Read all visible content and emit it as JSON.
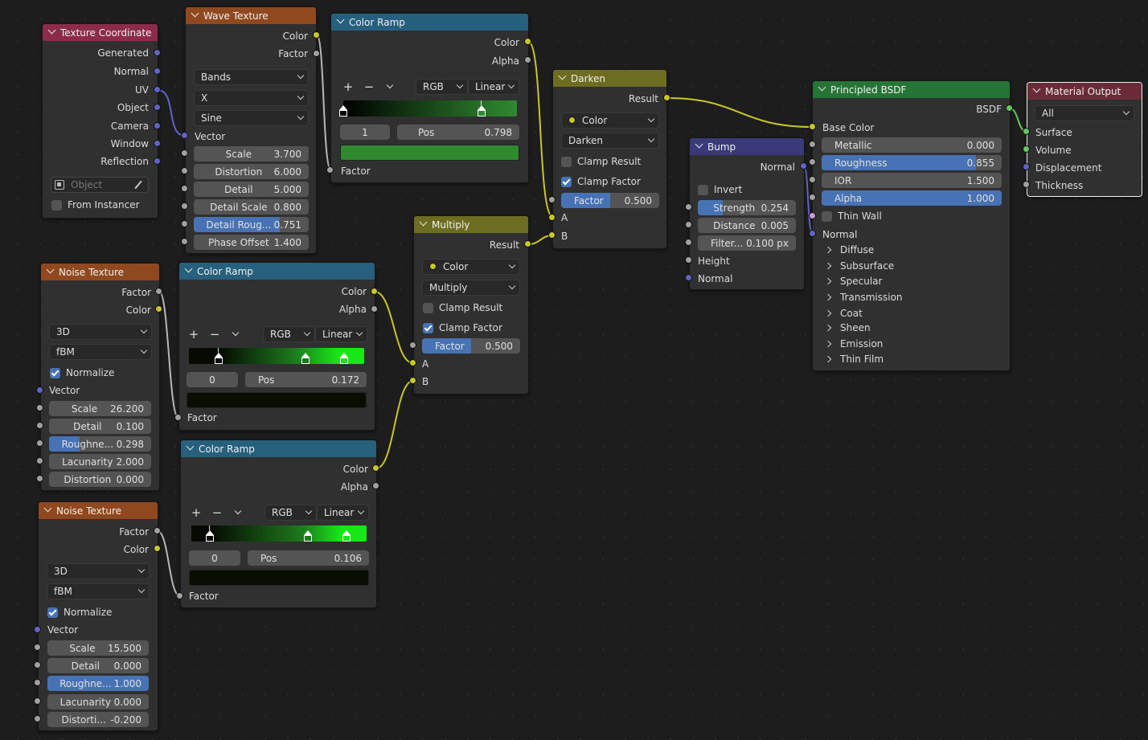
{
  "nodes": {
    "tex_coord": {
      "title": "Texture Coordinate",
      "outputs": [
        "Generated",
        "Normal",
        "UV",
        "Object",
        "Camera",
        "Window",
        "Reflection"
      ],
      "object_placeholder": "Object",
      "from_instancer": "From Instancer"
    },
    "wave": {
      "title": "Wave Texture",
      "outputs": [
        "Color",
        "Factor"
      ],
      "type": "Bands",
      "direction": "X",
      "profile": "Sine",
      "vector": "Vector",
      "fields": [
        {
          "label": "Scale",
          "value": "3.700"
        },
        {
          "label": "Distortion",
          "value": "6.000"
        },
        {
          "label": "Detail",
          "value": "5.000"
        },
        {
          "label": "Detail Scale",
          "value": "0.800"
        },
        {
          "label": "Detail Roug...",
          "value": "0.751"
        },
        {
          "label": "Phase Offset",
          "value": "1.400"
        }
      ]
    },
    "ramp1": {
      "title": "Color Ramp",
      "outputs": [
        "Color",
        "Alpha"
      ],
      "mode": "RGB",
      "interp": "Linear",
      "index": "1",
      "pos_label": "Pos",
      "pos": "0.798",
      "input": "Factor",
      "swatch": "#2f8a2f"
    },
    "darken": {
      "title": "Darken",
      "output": "Result",
      "data_type": "Color",
      "blend": "Darken",
      "clamp_result": "Clamp Result",
      "clamp_factor": "Clamp Factor",
      "factor_label": "Factor",
      "factor": "0.500",
      "inputs": [
        "A",
        "B"
      ]
    },
    "multiply": {
      "title": "Multiply",
      "output": "Result",
      "data_type": "Color",
      "blend": "Multiply",
      "clamp_result": "Clamp Result",
      "clamp_factor": "Clamp Factor",
      "factor_label": "Factor",
      "factor": "0.500",
      "inputs": [
        "A",
        "B"
      ]
    },
    "bump": {
      "title": "Bump",
      "output": "Normal",
      "invert": "Invert",
      "fields": [
        {
          "label": "Strength",
          "value": "0.254"
        },
        {
          "label": "Distance",
          "value": "0.005"
        },
        {
          "label": "Filter...",
          "value": "0.100 px"
        }
      ],
      "inputs": [
        "Height",
        "Normal"
      ]
    },
    "bsdf": {
      "title": "Principled BSDF",
      "output": "BSDF",
      "base_color": "Base Color",
      "fields": [
        {
          "label": "Metallic",
          "value": "0.000"
        },
        {
          "label": "Roughness",
          "value": "0.855"
        },
        {
          "label": "IOR",
          "value": "1.500"
        },
        {
          "label": "Alpha",
          "value": "1.000"
        }
      ],
      "thin_wall": "Thin Wall",
      "normal": "Normal",
      "panels": [
        "Diffuse",
        "Subsurface",
        "Specular",
        "Transmission",
        "Coat",
        "Sheen",
        "Emission",
        "Thin Film"
      ]
    },
    "output": {
      "title": "Material Output",
      "target": "All",
      "inputs": [
        "Surface",
        "Volume",
        "Displacement",
        "Thickness"
      ]
    },
    "noise1": {
      "title": "Noise Texture",
      "outputs": [
        "Factor",
        "Color"
      ],
      "dims": "3D",
      "type": "fBM",
      "normalize": "Normalize",
      "vector": "Vector",
      "fields": [
        {
          "label": "Scale",
          "value": "26.200"
        },
        {
          "label": "Detail",
          "value": "0.100"
        },
        {
          "label": "Roughne...",
          "value": "0.298"
        },
        {
          "label": "Lacunarity",
          "value": "2.000"
        },
        {
          "label": "Distortion",
          "value": "0.000"
        }
      ]
    },
    "ramp2": {
      "title": "Color Ramp",
      "outputs": [
        "Color",
        "Alpha"
      ],
      "mode": "RGB",
      "interp": "Linear",
      "index": "0",
      "pos_label": "Pos",
      "pos": "0.172",
      "input": "Factor",
      "swatch": "#080f02"
    },
    "ramp3": {
      "title": "Color Ramp",
      "outputs": [
        "Color",
        "Alpha"
      ],
      "mode": "RGB",
      "interp": "Linear",
      "index": "0",
      "pos_label": "Pos",
      "pos": "0.106",
      "input": "Factor",
      "swatch": "#080f02"
    },
    "noise2": {
      "title": "Noise Texture",
      "outputs": [
        "Factor",
        "Color"
      ],
      "dims": "3D",
      "type": "fBM",
      "normalize": "Normalize",
      "vector": "Vector",
      "fields": [
        {
          "label": "Scale",
          "value": "15.500"
        },
        {
          "label": "Detail",
          "value": "0.000"
        },
        {
          "label": "Roughne...",
          "value": "1.000"
        },
        {
          "label": "Lacunarity",
          "value": "0.000"
        },
        {
          "label": "Distorti...",
          "value": "-0.200"
        }
      ]
    }
  },
  "colors": {
    "texture_header": "#90491f",
    "converter_header": "#26607d",
    "mix_header": "#6d6d22",
    "vector_header": "#3a3a7a",
    "shader_header": "#277437",
    "output_header": "#6a2a38",
    "input_header": "#8a2c4a",
    "slider_fill": "#4772b3",
    "color_socket": "#c7c729",
    "float_socket": "#a1a1a1",
    "vector_socket": "#6363c7",
    "shader_socket": "#63c763"
  },
  "slider_fill_levels": {
    "wave_detail_roughness": 0.751,
    "bsdf_roughness": 0.855,
    "bsdf_alpha": 1.0,
    "noise1_roughness": 0.298,
    "noise2_roughness": 1.0,
    "mix_factor": 0.5,
    "bump_strength": 0.254
  }
}
